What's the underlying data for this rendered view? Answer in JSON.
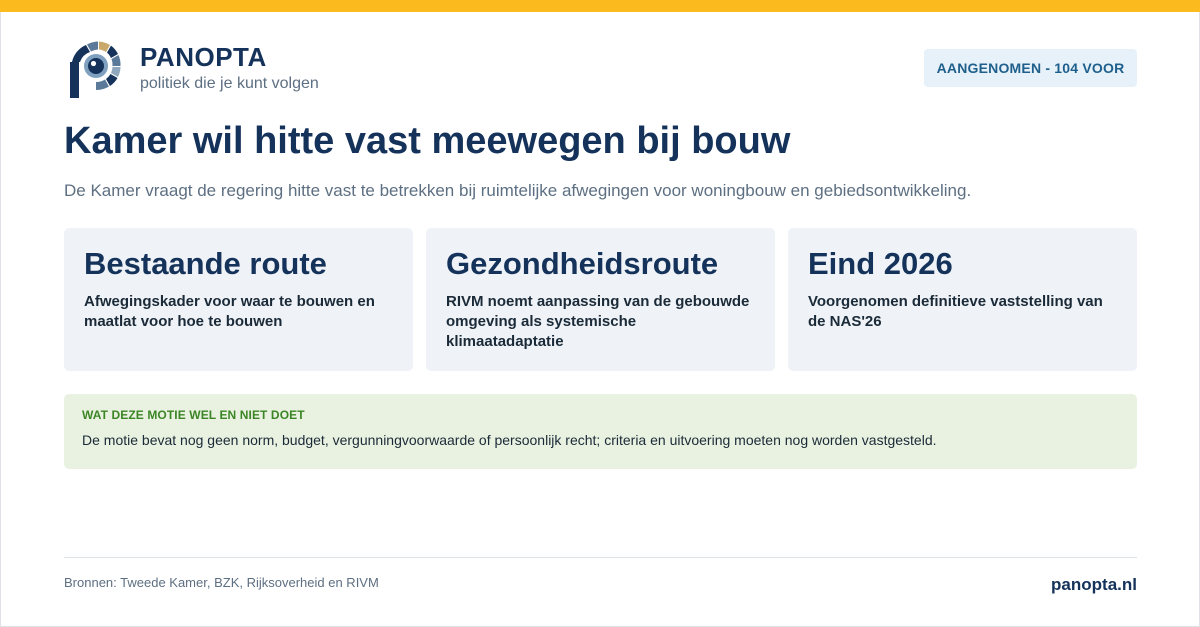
{
  "brand": {
    "name": "PANOPTA",
    "tagline": "politiek die je kunt volgen",
    "accent": "#fbba1e",
    "navy": "#14325a",
    "logo_icon": "panopta-eye-logo-icon"
  },
  "status_badge": "AANGENOMEN - 104 VOOR",
  "headline": "Kamer wil hitte vast meewegen bij bouw",
  "lede": "De Kamer vraagt de regering hitte vast te betrekken bij ruimtelijke afwegingen voor woningbouw en gebiedsontwikkeling.",
  "cards": [
    {
      "title": "Bestaande route",
      "desc": "Afwegingskader voor waar te bouwen en maatlat voor hoe te bouwen"
    },
    {
      "title": "Gezondheidsroute",
      "desc": "RIVM noemt aanpassing van de gebouwde omgeving als systemische klimaatadaptatie"
    },
    {
      "title": "Eind 2026",
      "desc": "Voorgenomen definitieve vaststelling van de NAS'26"
    }
  ],
  "note": {
    "title": "WAT DEZE MOTIE WEL EN NIET DOET",
    "text": "De motie bevat nog geen norm, budget, vergunningvoorwaarde of persoonlijk recht; criteria en uitvoering moeten nog worden vastgesteld."
  },
  "footer": {
    "sources": "Bronnen: Tweede Kamer, BZK, Rijksoverheid en RIVM",
    "site": "panopta.nl"
  }
}
